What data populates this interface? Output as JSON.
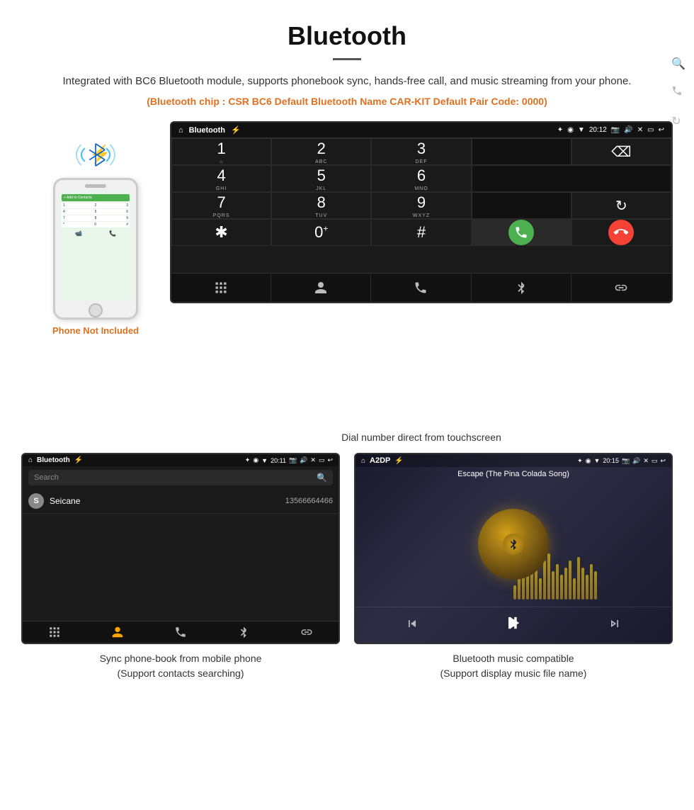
{
  "header": {
    "title": "Bluetooth",
    "description": "Integrated with BC6 Bluetooth module, supports phonebook sync, hands-free call, and music streaming from your phone.",
    "specs": "(Bluetooth chip : CSR BC6    Default Bluetooth Name CAR-KIT    Default Pair Code: 0000)"
  },
  "dial_screen": {
    "statusbar": {
      "left": "⌂",
      "center": "Bluetooth",
      "usb": "⚡",
      "right_icons": "✦ ◉ ▼ 20:12",
      "camera": "📷",
      "volume": "🔊",
      "x": "✕",
      "rect": "▭",
      "back": "↩"
    },
    "keys": [
      {
        "main": "1",
        "sub": "⌂"
      },
      {
        "main": "2",
        "sub": "ABC"
      },
      {
        "main": "3",
        "sub": "DEF"
      },
      {
        "main": "",
        "sub": ""
      },
      {
        "main": "⌫",
        "sub": ""
      },
      {
        "main": "4",
        "sub": "GHI"
      },
      {
        "main": "5",
        "sub": "JKL"
      },
      {
        "main": "6",
        "sub": "MNO"
      },
      {
        "main": "",
        "sub": ""
      },
      {
        "main": "",
        "sub": ""
      },
      {
        "main": "7",
        "sub": "PQRS"
      },
      {
        "main": "8",
        "sub": "TUV"
      },
      {
        "main": "9",
        "sub": "WXYZ"
      },
      {
        "main": "",
        "sub": ""
      },
      {
        "main": "↻",
        "sub": ""
      },
      {
        "main": "*",
        "sub": ""
      },
      {
        "main": "0",
        "sub": "+"
      },
      {
        "main": "#",
        "sub": ""
      },
      {
        "main": "📞",
        "sub": ""
      },
      {
        "main": "📞",
        "sub": ""
      }
    ],
    "bottom_bar": [
      "⊞",
      "👤",
      "📞",
      "✦",
      "🔗"
    ]
  },
  "caption_dial": "Dial number direct from touchscreen",
  "phonebook_screen": {
    "statusbar_left": "⌂  Bluetooth  ⚡",
    "statusbar_right": "✦ ◉ ▼ 20:11  📷  🔊  ✕  ▭  ↩",
    "search_placeholder": "Search",
    "contact": {
      "letter": "S",
      "name": "Seicane",
      "number": "13566664466"
    },
    "bottom_icons": [
      "⊞",
      "👤",
      "📞",
      "✦",
      "🔗"
    ]
  },
  "caption_phonebook": "Sync phone-book from mobile phone\n(Support contacts searching)",
  "music_screen": {
    "statusbar_left": "⌂  A2DP  ⚡",
    "statusbar_right": "✦ ◉ ▼ 20:15  📷  🔊  ✕  ▭  ↩",
    "song_title": "Escape (The Pina Colada Song)",
    "controls": [
      "⏮",
      "⏯",
      "⏭"
    ]
  },
  "caption_music": "Bluetooth music compatible\n(Support display music file name)",
  "phone_not_included": "Phone Not Included",
  "eq_bars": [
    20,
    35,
    50,
    40,
    60,
    45,
    30,
    55,
    65,
    40,
    50,
    35,
    45,
    55,
    30,
    60,
    45,
    35,
    50,
    40
  ]
}
